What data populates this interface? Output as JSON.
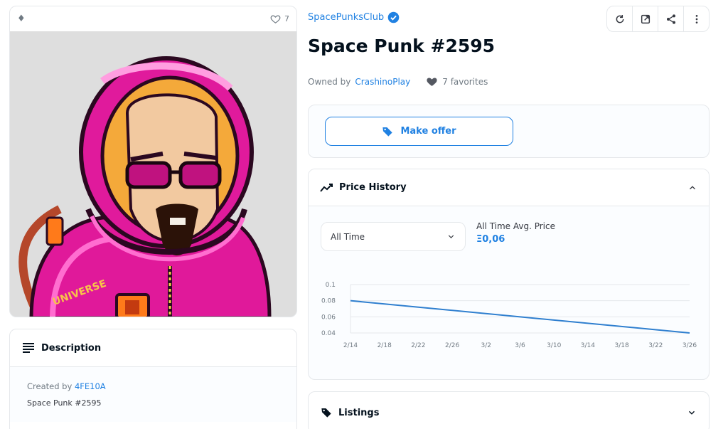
{
  "asset": {
    "favorites_count": "7",
    "collection_name": "SpacePunksClub",
    "title": "Space Punk #2595",
    "owned_by_prefix": "Owned by",
    "owner_name": "CrashinoPlay",
    "favorites_text": "7 favorites"
  },
  "offer": {
    "button_label": "Make offer"
  },
  "price_history": {
    "heading": "Price History",
    "range_selected": "All Time",
    "avg_label": "All Time Avg. Price",
    "avg_value": "Ξ0,06"
  },
  "description": {
    "heading": "Description",
    "created_by_prefix": "Created by",
    "creator": "4FE10A",
    "text": "Space Punk #2595"
  },
  "listings": {
    "heading": "Listings"
  },
  "colors": {
    "accent": "#2081e2",
    "helmet": "#e91e8c",
    "line": "#2f7fcf"
  },
  "chart_data": {
    "type": "line",
    "title": "",
    "xlabel": "",
    "ylabel": "",
    "x_ticks": [
      "2/14",
      "2/18",
      "2/22",
      "2/26",
      "3/2",
      "3/6",
      "3/10",
      "3/14",
      "3/18",
      "3/22",
      "3/26"
    ],
    "y_ticks": [
      "0.04",
      "0.06",
      "0.08",
      "0.1"
    ],
    "ylim": [
      0.04,
      0.1
    ],
    "grid": true,
    "series": [
      {
        "x": [
          "2/14",
          "3/26"
        ],
        "values": [
          0.08,
          0.04
        ]
      }
    ]
  }
}
